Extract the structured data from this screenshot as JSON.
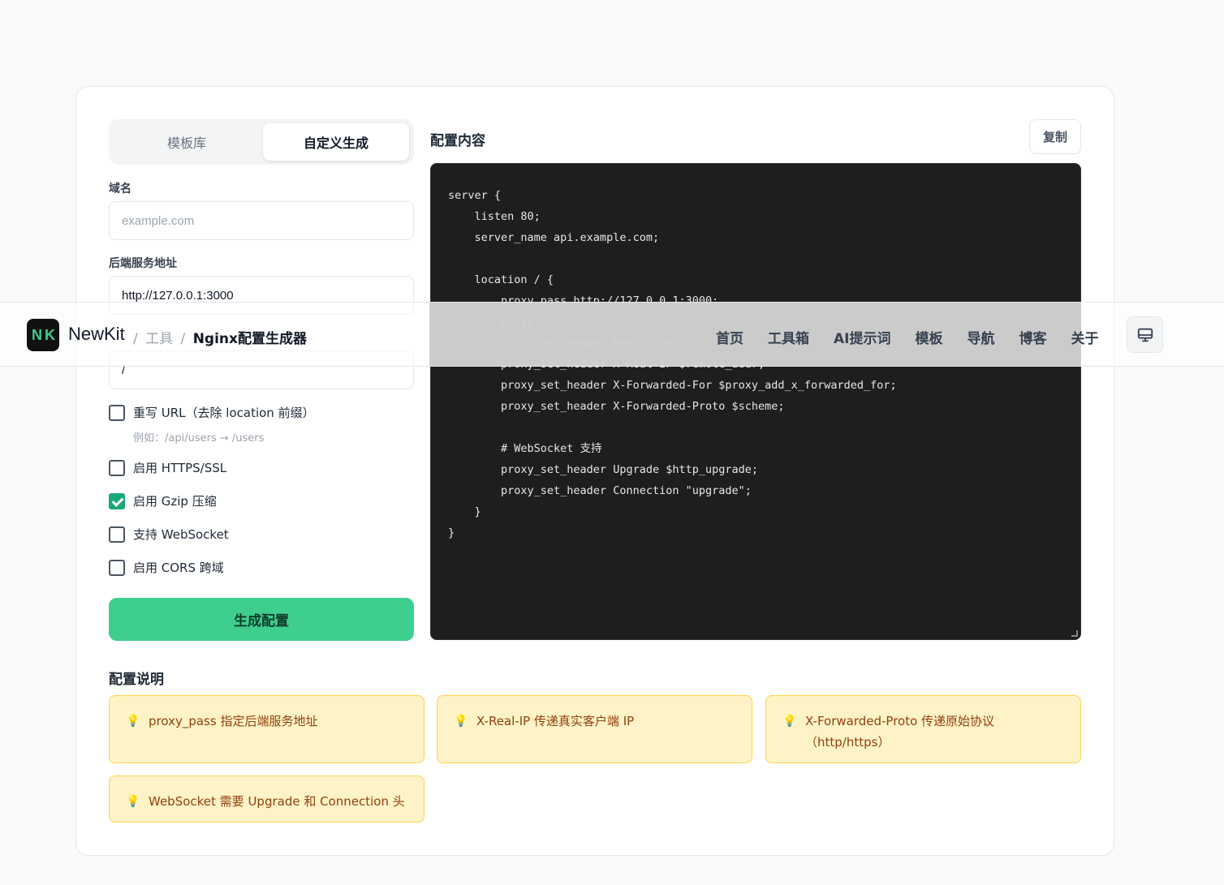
{
  "header": {
    "logo_text": "N K",
    "brand": "NewKit",
    "breadcrumb": [
      "工具",
      "Nginx配置生成器"
    ],
    "breadcrumb_sep": "/",
    "nav": [
      "首页",
      "工具箱",
      "AI提示词",
      "模板",
      "导航",
      "博客",
      "关于"
    ]
  },
  "tabs": {
    "template": "模板库",
    "custom": "自定义生成"
  },
  "form": {
    "domain_label": "域名",
    "domain_placeholder": "example.com",
    "domain_value": "",
    "backend_label": "后端服务地址",
    "backend_value": "http://127.0.0.1:3000",
    "location_value": "/",
    "rewrite_label": "重写 URL（去除 location 前缀）",
    "rewrite_hint": "例如：/api/users → /users",
    "https_label": "启用 HTTPS/SSL",
    "gzip_label": "启用 Gzip 压缩",
    "websocket_label": "支持 WebSocket",
    "cors_label": "启用 CORS 跨域",
    "generate_label": "生成配置"
  },
  "config": {
    "title": "配置内容",
    "copy_label": "复制",
    "code": "server {\n    listen 80;\n    server_name api.example.com;\n\n    location / {\n        proxy_pass http://127.0.0.1:3000;\n        proxy_http_version 1.1;\n        proxy_set_header Host $host;\n        proxy_set_header X-Real-IP $remote_addr;\n        proxy_set_header X-Forwarded-For $proxy_add_x_forwarded_for;\n        proxy_set_header X-Forwarded-Proto $scheme;\n\n        # WebSocket 支持\n        proxy_set_header Upgrade $http_upgrade;\n        proxy_set_header Connection \"upgrade\";\n    }\n}"
  },
  "explain": {
    "title": "配置说明",
    "tips": [
      "proxy_pass 指定后端服务地址",
      "X-Real-IP 传递真实客户端 IP",
      "X-Forwarded-Proto 传递原始协议（http/https）",
      "WebSocket 需要 Upgrade 和 Connection 头"
    ]
  },
  "colors": {
    "accent": "#3ecf8e",
    "code_bg": "#1e1e1e",
    "tip_bg": "#fef3c7"
  }
}
